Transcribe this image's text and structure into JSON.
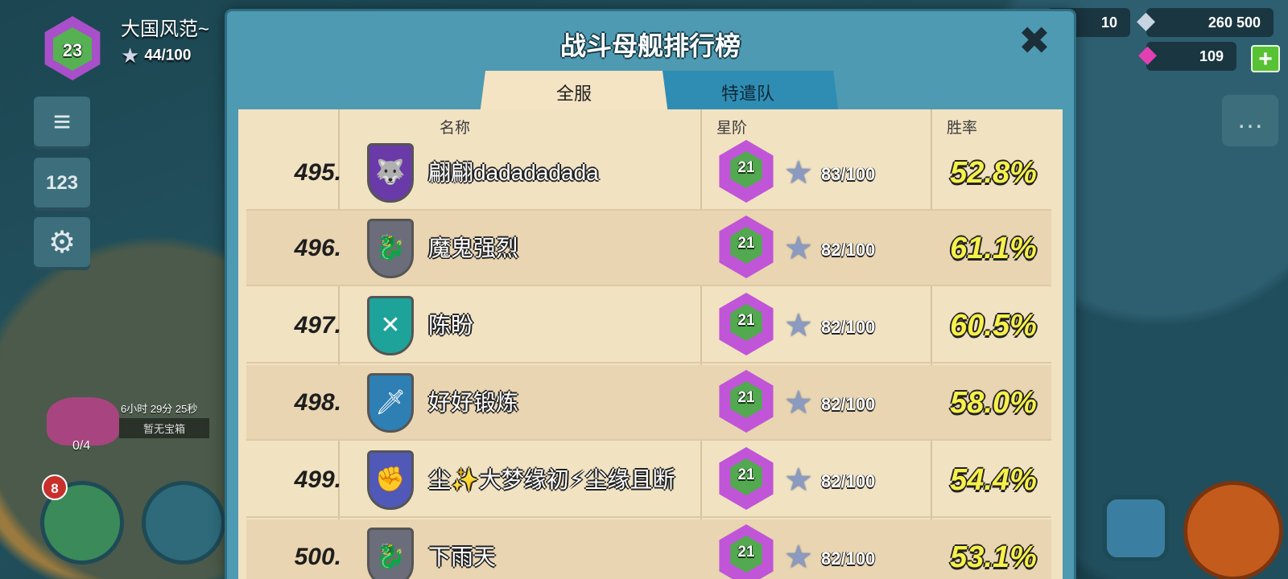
{
  "player": {
    "level": "23",
    "name": "大国风范~",
    "xp": "44/100"
  },
  "resources": {
    "gold": "10",
    "iron": "260 500",
    "gems": "109",
    "add_gems": "+"
  },
  "side_buttons": {
    "menu_icon": "≡",
    "ranking_icon": "123",
    "settings_icon": "⚙"
  },
  "chest": {
    "timer": "6小时 29分 25秒",
    "status": "暂无宝箱",
    "count": "0/4"
  },
  "troops_badge": "8",
  "chat_icon": "…",
  "modal": {
    "title": "战斗母舰排行榜",
    "close": "✖",
    "tabs": {
      "all": "全服",
      "team": "特遣队"
    },
    "columns": {
      "name": "名称",
      "rank": "星阶",
      "winrate": "胜率"
    },
    "rows": [
      {
        "rank": "495.",
        "name": "翩翩dadadadada",
        "level": "21",
        "stars": "83/100",
        "winrate": "52.8%",
        "crest": "purple",
        "crest_icon": "wolf-icon"
      },
      {
        "rank": "496.",
        "name": "魔鬼强烈",
        "level": "21",
        "stars": "82/100",
        "winrate": "61.1%",
        "crest": "grey",
        "crest_icon": "dragon-icon"
      },
      {
        "rank": "497.",
        "name": "陈盼",
        "level": "21",
        "stars": "82/100",
        "winrate": "60.5%",
        "crest": "teal",
        "crest_icon": "crossed-rifles-icon"
      },
      {
        "rank": "498.",
        "name": "好好锻炼",
        "level": "21",
        "stars": "82/100",
        "winrate": "58.0%",
        "crest": "blue",
        "crest_icon": "dagger-icon"
      },
      {
        "rank": "499.",
        "name": "尘✨大梦缘初⚡尘缘且断",
        "level": "21",
        "stars": "82/100",
        "winrate": "54.4%",
        "crest": "violet",
        "crest_icon": "fist-icon"
      },
      {
        "rank": "500.",
        "name": "下雨天",
        "level": "21",
        "stars": "82/100",
        "winrate": "53.1%",
        "crest": "grey",
        "crest_icon": "dragon-icon"
      }
    ]
  },
  "colors": {
    "modal_frame": "#4d9ab2",
    "parchment": "#f1e2c2",
    "winrate_yellow": "#f7f04a",
    "rank_badge_purple": "#c055d8",
    "rank_badge_green": "#52a94f"
  }
}
